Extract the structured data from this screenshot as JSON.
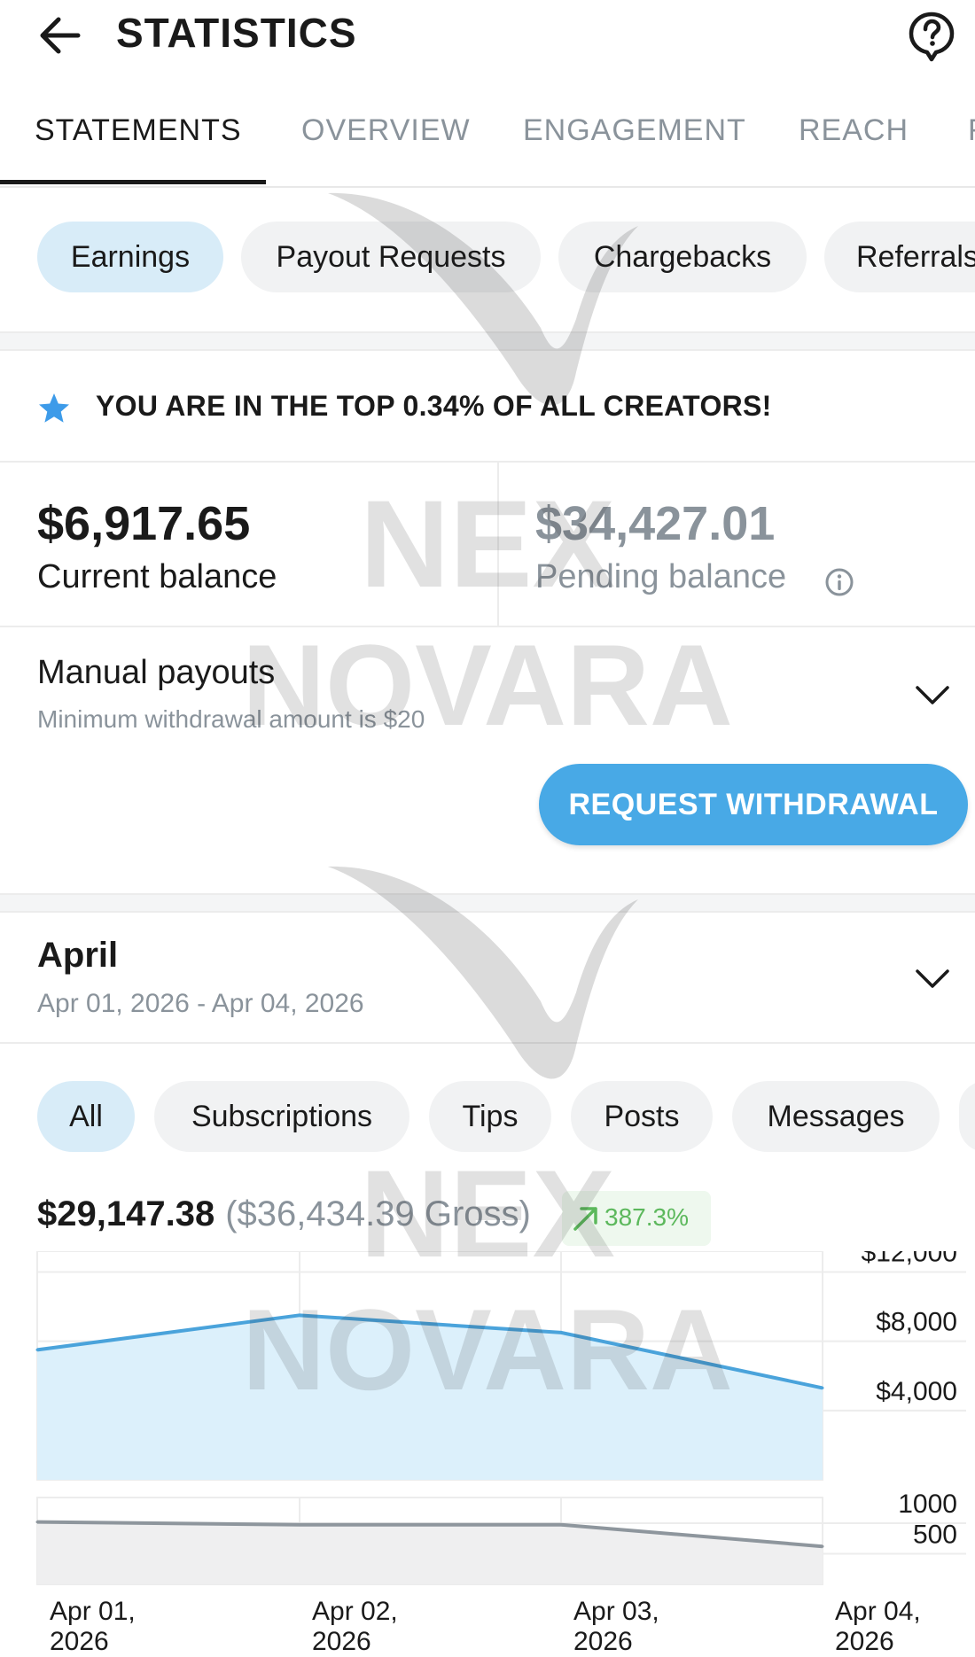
{
  "header": {
    "title": "STATISTICS",
    "back_icon": "arrow-left-icon",
    "help_icon": "help-circle-icon"
  },
  "tabs": [
    {
      "label": "STATEMENTS",
      "active": true
    },
    {
      "label": "OVERVIEW",
      "active": false
    },
    {
      "label": "ENGAGEMENT",
      "active": false
    },
    {
      "label": "REACH",
      "active": false
    },
    {
      "label": "F",
      "active": false
    }
  ],
  "statement_filters": [
    {
      "label": "Earnings",
      "active": true
    },
    {
      "label": "Payout Requests",
      "active": false
    },
    {
      "label": "Chargebacks",
      "active": false
    },
    {
      "label": "Referrals",
      "active": false
    }
  ],
  "ranking": {
    "text": "YOU ARE IN THE TOP 0.34% OF ALL CREATORS!",
    "icon": "star-icon",
    "icon_color": "#3d9be9"
  },
  "balances": {
    "current": {
      "amount": "$6,917.65",
      "label": "Current balance"
    },
    "pending": {
      "amount": "$34,427.01",
      "label": "Pending balance"
    }
  },
  "payouts": {
    "title": "Manual payouts",
    "subtitle": "Minimum withdrawal amount is $20",
    "button_label": "REQUEST WITHDRAWAL",
    "button_color": "#48a9e6"
  },
  "period": {
    "title": "April",
    "range": "Apr 01, 2026 - Apr 04, 2026"
  },
  "earning_filters": [
    {
      "label": "All",
      "active": true
    },
    {
      "label": "Subscriptions",
      "active": false
    },
    {
      "label": "Tips",
      "active": false
    },
    {
      "label": "Posts",
      "active": false
    },
    {
      "label": "Messages",
      "active": false
    }
  ],
  "totals": {
    "net": "$29,147.38",
    "gross": "($36,434.39 Gross)",
    "change": "387.3%",
    "change_color": "#5cb85c"
  },
  "watermark": {
    "line1": "NEX",
    "line2": "NOVARA"
  },
  "chart_data": [
    {
      "type": "area",
      "x": [
        "Apr 01, 2026",
        "Apr 02, 2026",
        "Apr 03, 2026",
        "Apr 04, 2026"
      ],
      "series": [
        {
          "values": [
            7500,
            9500,
            8500,
            5300
          ]
        }
      ],
      "y_ticks": [
        12000,
        8000,
        4000
      ],
      "y_tick_labels": [
        "$12,000",
        "$8,000",
        "$4,000"
      ],
      "ylim": [
        0,
        13200
      ],
      "y_axis_position": "right",
      "line_color": "#4aa3db",
      "fill_color": "#dcf0fb",
      "grid": true
    },
    {
      "type": "area",
      "x": [
        "Apr 01, 2026",
        "Apr 02, 2026",
        "Apr 03, 2026",
        "Apr 04, 2026"
      ],
      "series": [
        {
          "values": [
            1020,
            975,
            975,
            620
          ]
        }
      ],
      "y_ticks": [
        1000,
        500
      ],
      "y_tick_labels": [
        "1000",
        "500"
      ],
      "ylim": [
        0,
        1420
      ],
      "y_axis_position": "right",
      "line_color": "#8e969d",
      "fill_color": "#efeff0",
      "grid": true,
      "x_tick_labels": [
        [
          "Apr 01,",
          "2026"
        ],
        [
          "Apr 02,",
          "2026"
        ],
        [
          "Apr 03,",
          "2026"
        ],
        [
          "Apr 04,",
          "2026"
        ]
      ]
    }
  ]
}
